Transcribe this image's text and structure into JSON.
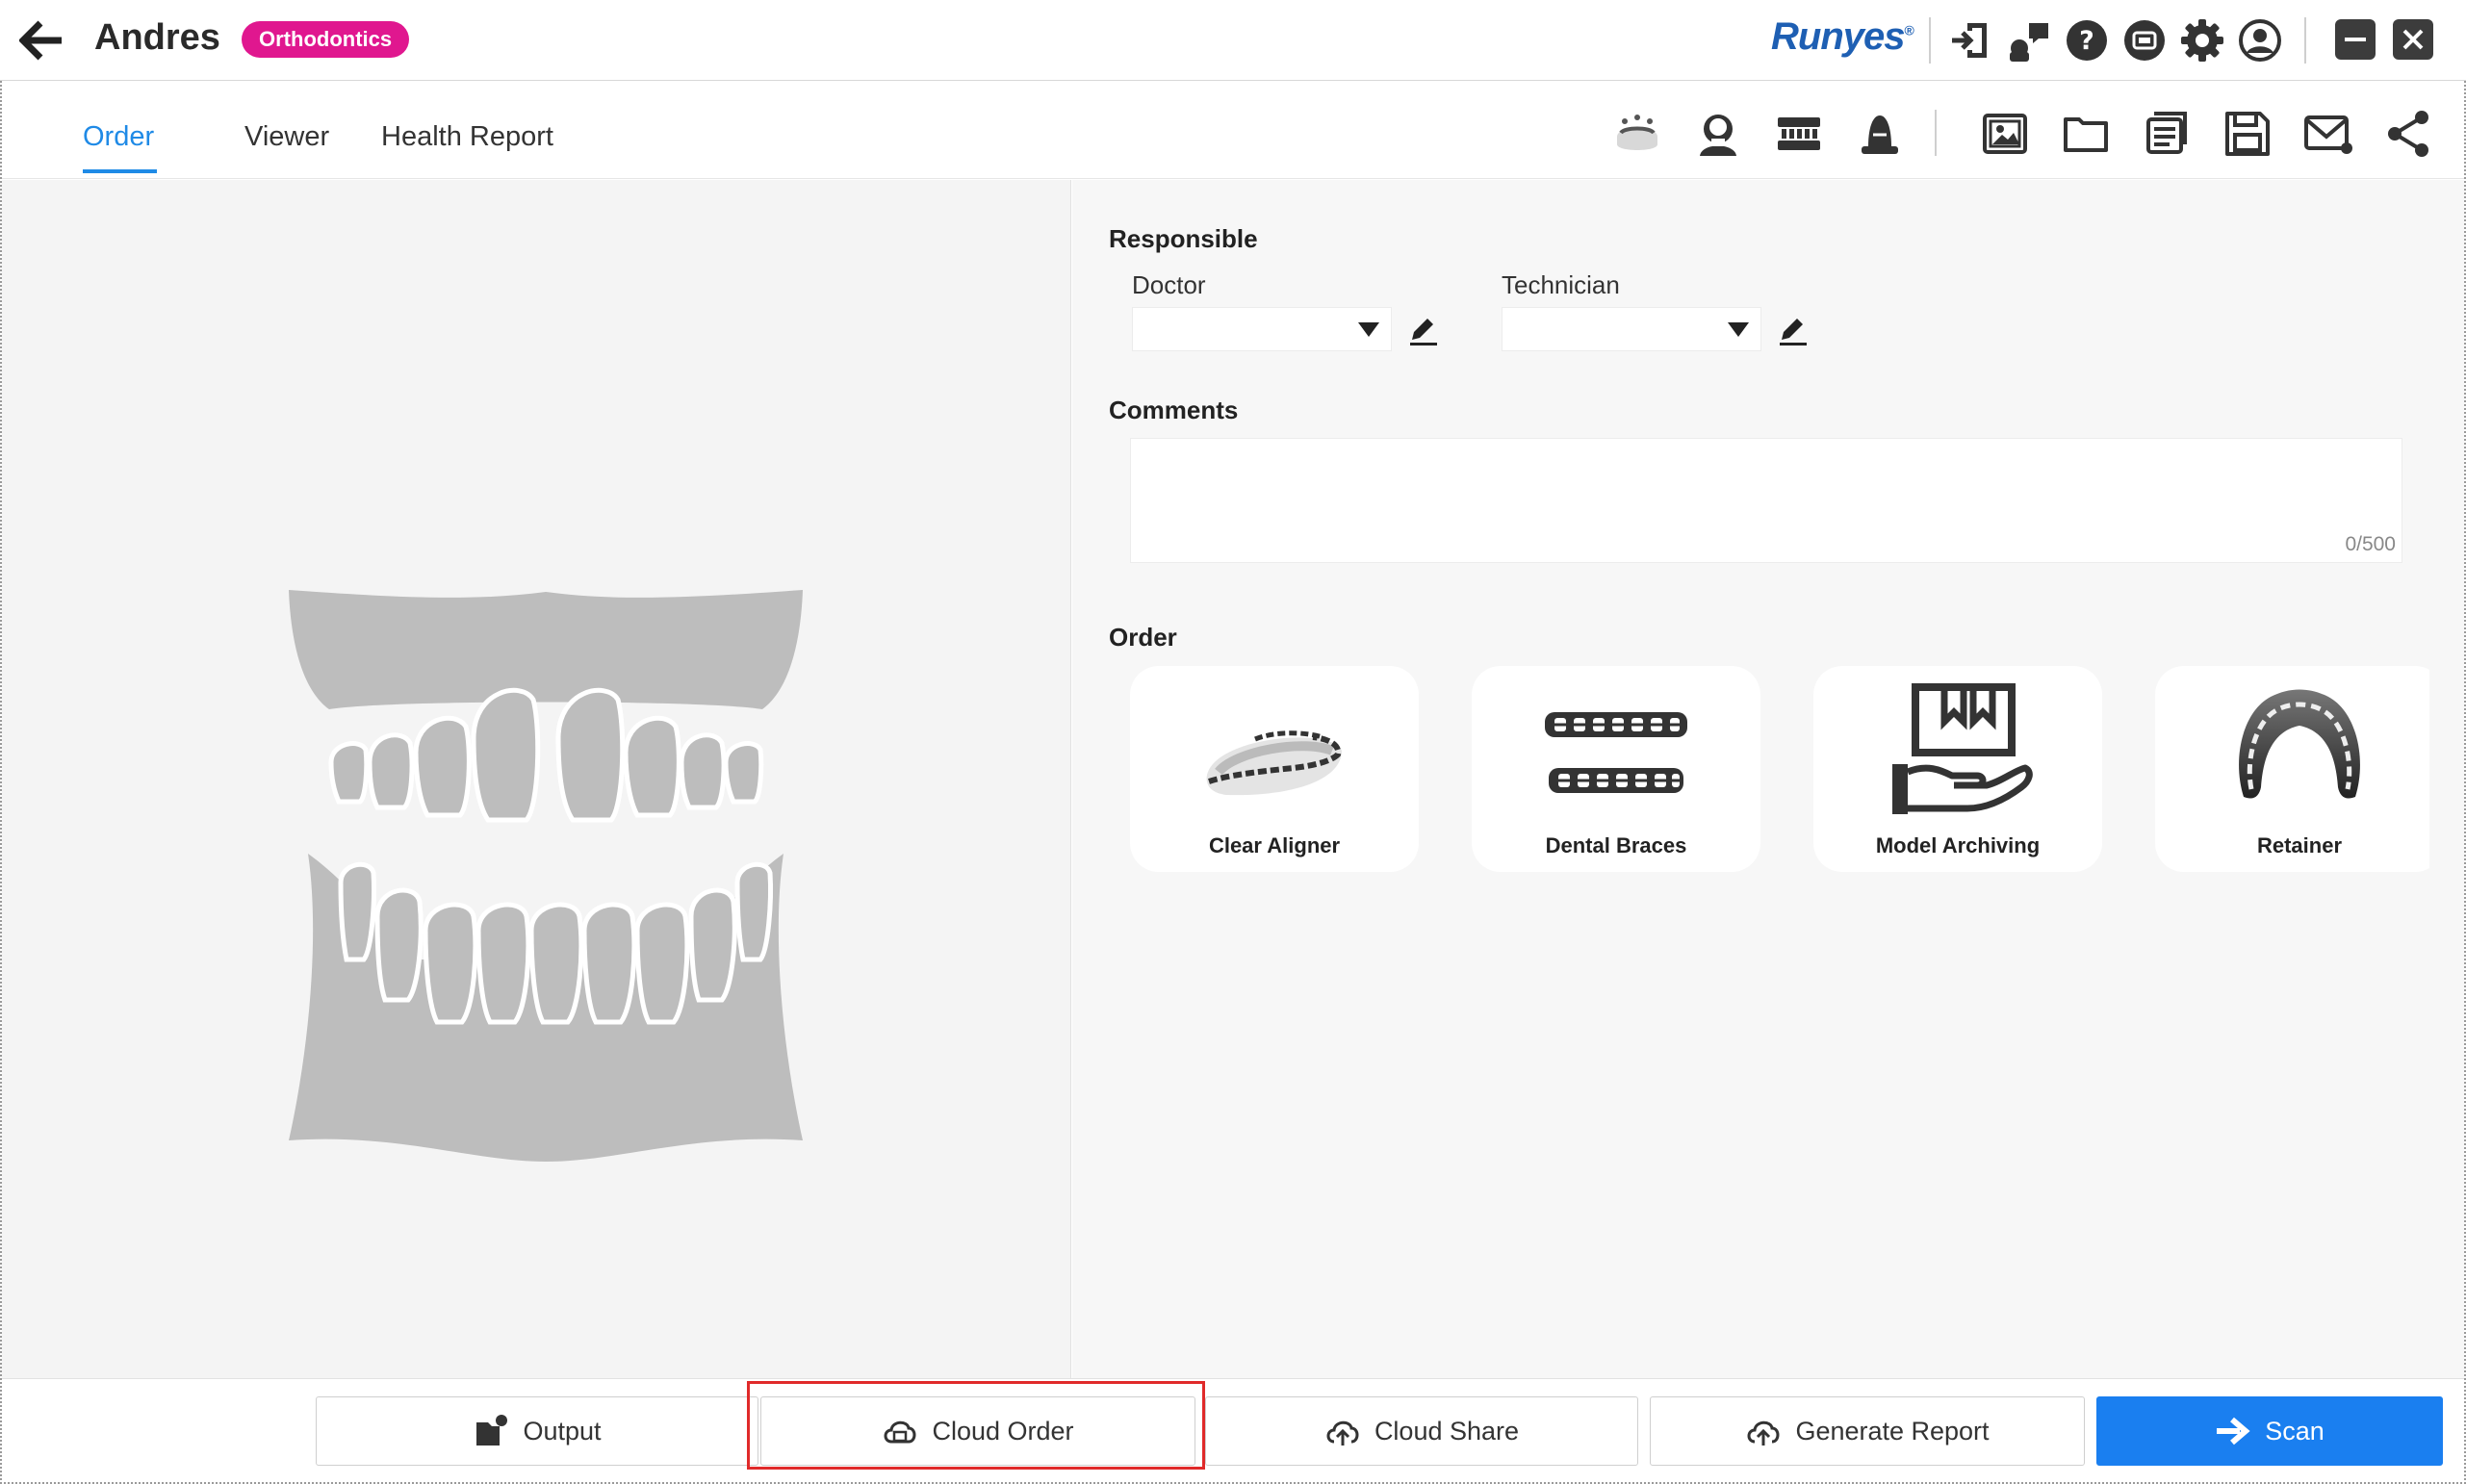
{
  "header": {
    "patient_name": "Andres",
    "category_tag": "Orthodontics",
    "brand": "Runyes",
    "brand_mark": "®",
    "icons": [
      "import-icon",
      "chat-icon",
      "help-icon",
      "cloud-device-icon",
      "settings-icon",
      "user-account-icon"
    ],
    "window_controls": [
      "minimize-icon",
      "close-icon"
    ],
    "accent_color": "#1f8ae6",
    "tag_color": "#e0178f"
  },
  "tabs": [
    {
      "label": "Order",
      "active": true
    },
    {
      "label": "Viewer",
      "active": false
    },
    {
      "label": "Health Report",
      "active": false
    }
  ],
  "toolbar_icons": [
    "scan-model-icon",
    "patient-portrait-icon",
    "dental-arch-icon",
    "single-tooth-icon",
    "image-gallery-icon",
    "folder-icon",
    "document-list-icon",
    "save-icon",
    "email-icon",
    "share-icon"
  ],
  "form": {
    "responsible_title": "Responsible",
    "doctor_label": "Doctor",
    "doctor_value": "",
    "technician_label": "Technician",
    "technician_value": "",
    "comments_title": "Comments",
    "comments_value": "",
    "comments_count": "0/500",
    "order_title": "Order",
    "order_items": [
      {
        "label": "Clear Aligner",
        "icon": "clear-aligner-icon"
      },
      {
        "label": "Dental Braces",
        "icon": "dental-braces-icon"
      },
      {
        "label": "Model Archiving",
        "icon": "model-archiving-icon"
      },
      {
        "label": "Retainer",
        "icon": "retainer-icon"
      }
    ]
  },
  "bottom_bar": {
    "output_label": "Output",
    "cloud_order_label": "Cloud Order",
    "cloud_share_label": "Cloud Share",
    "generate_report_label": "Generate Report",
    "scan_label": "Scan",
    "primary_color": "#1a7ff0",
    "highlight_color": "#e02a2a"
  }
}
